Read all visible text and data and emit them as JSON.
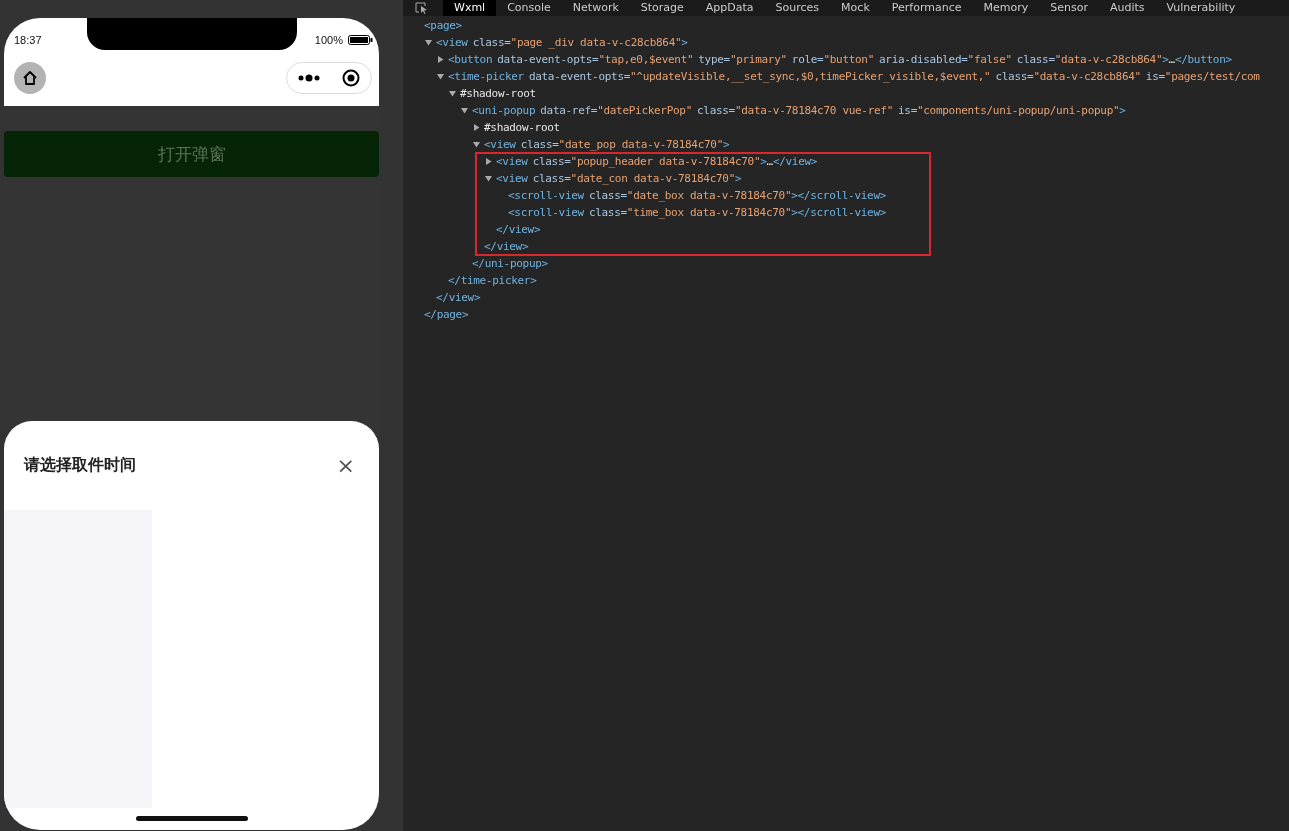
{
  "simulator": {
    "status_bar": {
      "time": "18:37",
      "battery": "100%"
    },
    "page": {
      "button": "打开弹窗"
    },
    "popup": {
      "title": "请选择取件时间",
      "close": "×"
    }
  },
  "devtools": {
    "tabs": [
      {
        "label": "Wxml",
        "selected": true
      },
      {
        "label": "Console",
        "selected": false
      },
      {
        "label": "Network",
        "selected": false
      },
      {
        "label": "Storage",
        "selected": false
      },
      {
        "label": "AppData",
        "selected": false
      },
      {
        "label": "Sources",
        "selected": false
      },
      {
        "label": "Mock",
        "selected": false
      },
      {
        "label": "Performance",
        "selected": false
      },
      {
        "label": "Memory",
        "selected": false
      },
      {
        "label": "Sensor",
        "selected": false
      },
      {
        "label": "Audits",
        "selected": false
      },
      {
        "label": "Vulnerability",
        "selected": false
      }
    ]
  },
  "dom_tree": [
    {
      "open": [
        {
          "kind": "tag",
          "text": "<page>"
        }
      ],
      "close": [
        {
          "kind": "tag",
          "text": "</page>"
        }
      ],
      "children": [
        {
          "expanded": true,
          "open": [
            {
              "kind": "tag",
              "text": "<view"
            },
            {
              "kind": "attr",
              "text": "class="
            },
            {
              "kind": "value",
              "text": "\"page _div data-v-c28cb864\""
            },
            {
              "kind": "tag",
              "text": ">"
            }
          ],
          "close": [
            {
              "kind": "tag",
              "text": "</view>"
            }
          ],
          "children": [
            {
              "expanded": false,
              "open": [
                {
                  "kind": "tag",
                  "text": "<button"
                },
                {
                  "kind": "attr",
                  "text": "data-event-opts="
                },
                {
                  "kind": "value",
                  "text": "\"tap,e0,$event\""
                },
                {
                  "kind": "attr",
                  "text": "type="
                },
                {
                  "kind": "value",
                  "text": "\"primary\""
                },
                {
                  "kind": "attr",
                  "text": "role="
                },
                {
                  "kind": "value",
                  "text": "\"button\""
                },
                {
                  "kind": "attr",
                  "text": "aria-disabled="
                },
                {
                  "kind": "value",
                  "text": "\"false\""
                },
                {
                  "kind": "attr",
                  "text": "class="
                },
                {
                  "kind": "value",
                  "text": "\"data-v-c28cb864\""
                },
                {
                  "kind": "tag",
                  "text": ">"
                },
                {
                  "kind": "plain",
                  "text": "…"
                },
                {
                  "kind": "tag",
                  "text": "</button>"
                }
              ]
            },
            {
              "expanded": true,
              "open": [
                {
                  "kind": "tag",
                  "text": "<time-picker"
                },
                {
                  "kind": "attr",
                  "text": "data-event-opts="
                },
                {
                  "kind": "value",
                  "text": "\"^updateVisible,__set_sync,$0,timePicker_visible,$event,\""
                },
                {
                  "kind": "attr",
                  "text": "class="
                },
                {
                  "kind": "value",
                  "text": "\"data-v-c28cb864\""
                },
                {
                  "kind": "attr",
                  "text": "is="
                },
                {
                  "kind": "value",
                  "text": "\"pages/test/com"
                }
              ],
              "close": [
                {
                  "kind": "tag",
                  "text": "</time-picker>"
                }
              ],
              "children": [
                {
                  "expanded": true,
                  "open": [
                    {
                      "kind": "plain",
                      "text": "#shadow-root"
                    }
                  ],
                  "children": [
                    {
                      "expanded": true,
                      "open": [
                        {
                          "kind": "tag",
                          "text": "<uni-popup"
                        },
                        {
                          "kind": "attr",
                          "text": "data-ref="
                        },
                        {
                          "kind": "value",
                          "text": "\"datePickerPop\""
                        },
                        {
                          "kind": "attr",
                          "text": "class="
                        },
                        {
                          "kind": "value",
                          "text": "\"data-v-78184c70 vue-ref\""
                        },
                        {
                          "kind": "attr",
                          "text": "is="
                        },
                        {
                          "kind": "value",
                          "text": "\"components/uni-popup/uni-popup\""
                        },
                        {
                          "kind": "tag",
                          "text": ">"
                        }
                      ],
                      "close": [
                        {
                          "kind": "tag",
                          "text": "</uni-popup>"
                        }
                      ],
                      "children": [
                        {
                          "expanded": false,
                          "open": [
                            {
                              "kind": "plain",
                              "text": "#shadow-root"
                            }
                          ]
                        },
                        {
                          "expanded": true,
                          "close_highlighted": true,
                          "open": [
                            {
                              "kind": "tag",
                              "text": "<view"
                            },
                            {
                              "kind": "attr",
                              "text": "class="
                            },
                            {
                              "kind": "value",
                              "text": "\"date_pop data-v-78184c70\""
                            },
                            {
                              "kind": "tag",
                              "text": ">"
                            }
                          ],
                          "close": [
                            {
                              "kind": "tag",
                              "text": "</view>"
                            }
                          ],
                          "children": [
                            {
                              "expanded": false,
                              "highlighted": true,
                              "open": [
                                {
                                  "kind": "tag",
                                  "text": "<view"
                                },
                                {
                                  "kind": "attr",
                                  "text": "class="
                                },
                                {
                                  "kind": "value",
                                  "text": "\"popup_header data-v-78184c70\""
                                },
                                {
                                  "kind": "tag",
                                  "text": ">"
                                },
                                {
                                  "kind": "plain",
                                  "text": "…"
                                },
                                {
                                  "kind": "tag",
                                  "text": "</view>"
                                }
                              ]
                            },
                            {
                              "expanded": true,
                              "highlighted": true,
                              "open": [
                                {
                                  "kind": "tag",
                                  "text": "<view"
                                },
                                {
                                  "kind": "attr",
                                  "text": "class="
                                },
                                {
                                  "kind": "value",
                                  "text": "\"date_con data-v-78184c70\""
                                },
                                {
                                  "kind": "tag",
                                  "text": ">"
                                }
                              ],
                              "close": [
                                {
                                  "kind": "tag",
                                  "text": "</view>"
                                }
                              ],
                              "children": [
                                {
                                  "open": [
                                    {
                                      "kind": "tag",
                                      "text": "<scroll-view"
                                    },
                                    {
                                      "kind": "attr",
                                      "text": "class="
                                    },
                                    {
                                      "kind": "value",
                                      "text": "\"date_box data-v-78184c70\""
                                    },
                                    {
                                      "kind": "tag",
                                      "text": "></scroll-view>"
                                    }
                                  ]
                                },
                                {
                                  "open": [
                                    {
                                      "kind": "tag",
                                      "text": "<scroll-view"
                                    },
                                    {
                                      "kind": "attr",
                                      "text": "class="
                                    },
                                    {
                                      "kind": "value",
                                      "text": "\"time_box data-v-78184c70\""
                                    },
                                    {
                                      "kind": "tag",
                                      "text": "></scroll-view>"
                                    }
                                  ]
                                }
                              ]
                            }
                          ]
                        }
                      ]
                    }
                  ]
                }
              ]
            }
          ]
        }
      ]
    }
  ]
}
